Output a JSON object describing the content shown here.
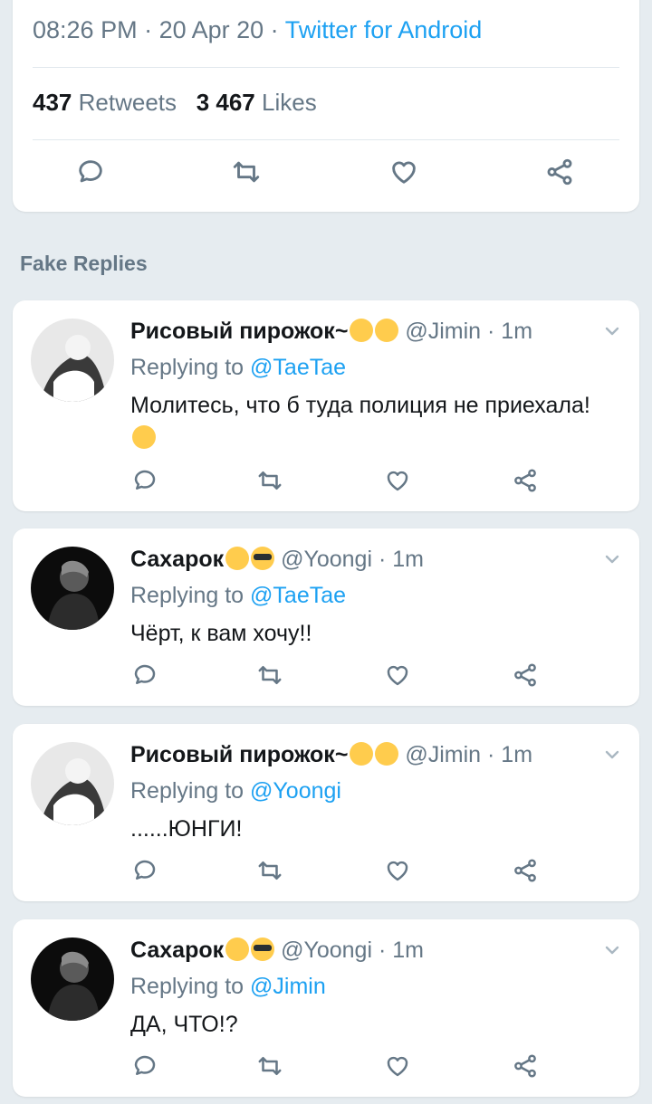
{
  "tweet": {
    "time": "08:26 PM",
    "date": "20 Apr 20",
    "sep": " · ",
    "app": "Twitter for Android",
    "retweets_count": "437",
    "retweets_label": "Retweets",
    "likes_count": "3 467",
    "likes_label": "Likes",
    "icons": [
      "reply-icon",
      "retweet-icon",
      "like-icon",
      "share-icon"
    ]
  },
  "section_title": "Fake Replies",
  "replies": [
    {
      "name": "Рисовый пирожок~",
      "emojis": [
        "smiling-face-with-hearts",
        "grinning-sweat"
      ],
      "handle": "@Jimin · 1m",
      "replying_prefix": "Replying to ",
      "replying_to": "@TaeTae",
      "text": "Молитесь, что б туда полиция не приехала!",
      "text_emoji": "face-with-rolling-eyes"
    },
    {
      "name": "Сахарок",
      "emojis": [
        "smirking-face",
        "smiling-face-with-sunglasses"
      ],
      "handle": "@Yoongi · 1m",
      "replying_prefix": "Replying to ",
      "replying_to": "@TaeTae",
      "text": "Чёрт, к вам хочу!!"
    },
    {
      "name": "Рисовый пирожок~",
      "emojis": [
        "smiling-face-with-hearts",
        "grinning-sweat"
      ],
      "handle": "@Jimin · 1m",
      "replying_prefix": "Replying to ",
      "replying_to": "@Yoongi",
      "text": "......ЮНГИ!"
    },
    {
      "name": "Сахарок",
      "emojis": [
        "smirking-face",
        "smiling-face-with-sunglasses"
      ],
      "handle": "@Yoongi · 1m",
      "replying_prefix": "Replying to ",
      "replying_to": "@Jimin",
      "text": "ДА, ЧТО!?"
    }
  ]
}
